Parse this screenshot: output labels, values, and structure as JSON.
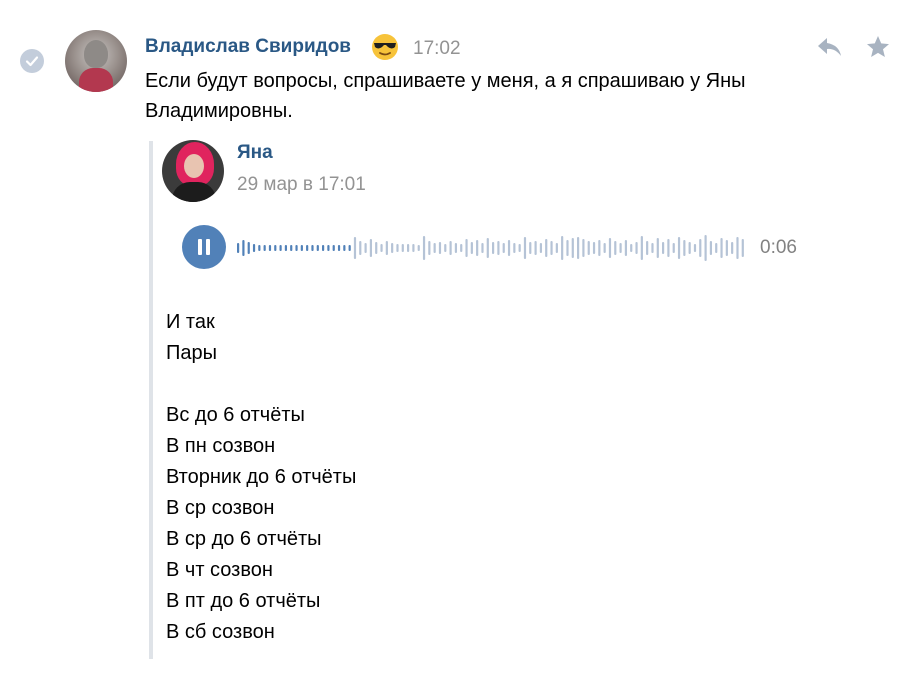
{
  "message": {
    "author": "Владислав Свиридов",
    "author_emoji": "sunglasses-emoji",
    "time": "17:02",
    "text": "Если будут вопросы, спрашиваете у меня, а я спрашиваю у Яны Владимировны.",
    "actions": [
      "reply-icon",
      "star-icon"
    ]
  },
  "forwarded": {
    "author": "Яна",
    "date": "29 мар в 17:01",
    "voice": {
      "state": "playing",
      "duration": "0:06"
    },
    "lines": [
      "И так",
      "Пары",
      "",
      "Вс до 6 отчёты",
      "В пн созвон",
      "Вторник до 6 отчёты",
      "В ср созвон",
      "В ср до 6 отчёты",
      "В чт созвон",
      "В пт до 6 отчёты",
      "В сб созвон"
    ]
  },
  "colors": {
    "link": "#2a5885",
    "meta": "#939393",
    "play_button": "#5181b8",
    "waveform_played": "#5181b8",
    "waveform_unplayed": "#b5c3d6"
  }
}
